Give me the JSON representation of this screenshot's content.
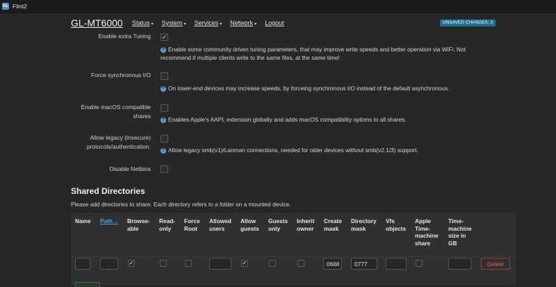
{
  "window": {
    "title": "Flint2",
    "icon": "app-icon"
  },
  "nav": {
    "brand": "GL-MT6000",
    "menu": [
      {
        "label": "Status",
        "caret": "▾"
      },
      {
        "label": "System",
        "caret": "▾"
      },
      {
        "label": "Services",
        "caret": "▾"
      },
      {
        "label": "Network",
        "caret": "▾"
      },
      {
        "label": "Logout",
        "caret": ""
      }
    ],
    "badge": "UNSAVED CHANGES: 3"
  },
  "settings": {
    "extra_tuning": {
      "label": "Enable extra Tuning",
      "checked": true,
      "check_glyph": "✓",
      "help_line1": "Enable some community driven tuning parameters, that may improve write speeds and better operation via WiFi. Not",
      "help_line2": "recommend if multiple clients write to the same files, at the same time!"
    },
    "force_sync": {
      "label": "Force synchronous I/O",
      "checked": false,
      "help": "On lower-end devices may increase speeds, by forceing synchronous I/O instead of the default asynchronous."
    },
    "macos": {
      "label_line1": "Enable macOS compatible",
      "label_line2": "shares",
      "checked": false,
      "help": "Enables Apple's AAPL extension globally and adds macOS compatibility options to all shares."
    },
    "legacy": {
      "label_line1": "Allow legacy (insecure)",
      "label_line2": "protocols/authentication.",
      "checked": false,
      "help": "Allow legacy smb(v1)/Lanman connections, needed for older devices without smb(v2.1/3) support."
    },
    "netbios": {
      "label": "Disable Netbios",
      "checked": false
    }
  },
  "shared": {
    "title": "Shared Directories",
    "description": "Please add directories to share. Each directory refers to a folder on a mounted device.",
    "headers": {
      "name": "Name",
      "path": "Path→",
      "browseable": "Browse-\nable",
      "readonly": "Read-\nonly",
      "force_root": "Force\nRoot",
      "allowed_users": "Allowed\nusers",
      "allow_guests": "Allow\nguests",
      "guests_only": "Guests\nonly",
      "inherit_owner": "Inherit\nowner",
      "create_mask": "Create\nmask",
      "directory_mask": "Directory\nmask",
      "vfs_objects": "Vfs\nobjects",
      "apple_tm": "Apple\nTime-\nmachine\nshare",
      "tm_size": "Time-\nmachine\nsize in\nGB"
    },
    "row": {
      "name": "",
      "path": "",
      "browseable": true,
      "readonly": false,
      "force_root": false,
      "allowed_users": "",
      "allow_guests": true,
      "guests_only": false,
      "inherit_owner": false,
      "create_mask": "0666",
      "directory_mask": "0777",
      "vfs_objects": "",
      "apple_tm": false,
      "tm_size": "",
      "delete_label": "Delete",
      "check_glyph": "✓"
    }
  },
  "icons": {
    "help": "?"
  }
}
